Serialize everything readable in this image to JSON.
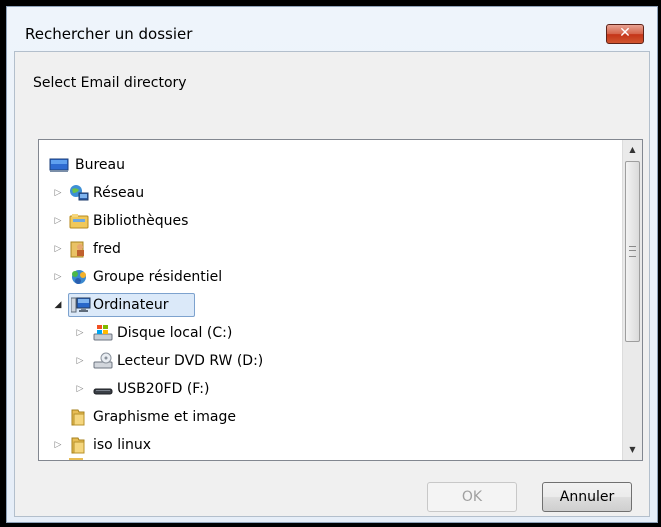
{
  "window": {
    "title": "Rechercher un dossier",
    "close_symbol": "✕"
  },
  "description": "Select Email directory",
  "tree": {
    "items": [
      {
        "label": "Bureau",
        "icon": "desktop-icon",
        "level": 0,
        "expander": "none"
      },
      {
        "label": "Réseau",
        "icon": "network-icon",
        "level": 1,
        "expander": "collapsed"
      },
      {
        "label": "Bibliothèques",
        "icon": "libraries-icon",
        "level": 1,
        "expander": "collapsed"
      },
      {
        "label": "fred",
        "icon": "user-folder-icon",
        "level": 1,
        "expander": "collapsed"
      },
      {
        "label": "Groupe résidentiel",
        "icon": "homegroup-icon",
        "level": 1,
        "expander": "collapsed"
      },
      {
        "label": "Ordinateur",
        "icon": "computer-icon",
        "level": 1,
        "expander": "expanded",
        "selected": true
      },
      {
        "label": "Disque local (C:)",
        "icon": "local-disk-icon",
        "level": 2,
        "expander": "collapsed"
      },
      {
        "label": "Lecteur DVD RW (D:)",
        "icon": "dvd-drive-icon",
        "level": 2,
        "expander": "collapsed"
      },
      {
        "label": "USB20FD (F:)",
        "icon": "usb-drive-icon",
        "level": 2,
        "expander": "collapsed"
      },
      {
        "label": "Graphisme et image",
        "icon": "folder-icon",
        "level": 1,
        "expander": "none"
      },
      {
        "label": "iso linux",
        "icon": "folder-icon",
        "level": 1,
        "expander": "collapsed"
      }
    ],
    "scroll_up_symbol": "▲",
    "scroll_down_symbol": "▼",
    "expander_collapsed_symbol": "▷",
    "expander_expanded_symbol": "◢"
  },
  "buttons": {
    "ok": "OK",
    "cancel": "Annuler"
  },
  "colors": {
    "selection_bg": "#dbe9f9",
    "selection_border": "#7da2ce",
    "close_red": "#c43418"
  }
}
